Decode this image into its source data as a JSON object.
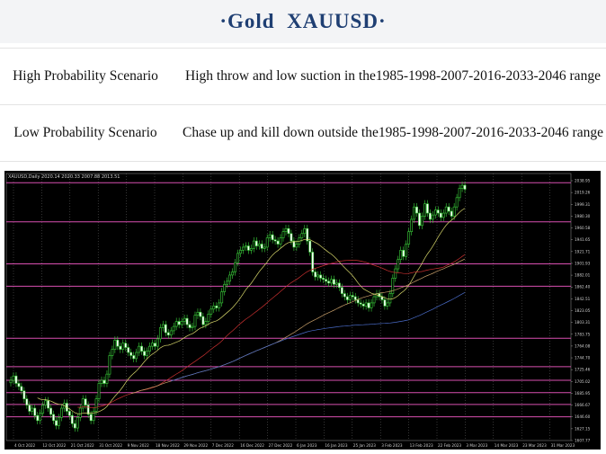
{
  "title": "·Gold  XAUUSD·",
  "scenarios": [
    {
      "label": "High Probability Scenario",
      "text": "High throw and low suction in the1985-1998-2007-2016-2033-2046 range"
    },
    {
      "label": "Low Probability Scenario",
      "text": "Chase up and kill down outside the1985-1998-2007-2016-2033-2046 range"
    }
  ],
  "chart_data": {
    "type": "line",
    "symbol_header": "XAUUSD,Daily  2020.14 2020.33 2007.88 2013.51",
    "x_tick_labels": [
      "4 Oct 2022",
      "12 Oct 2022",
      "21 Oct 2022",
      "31 Oct 2022",
      "9 Nov 2022",
      "18 Nov 2022",
      "29 Nov 2022",
      "7 Dec 2022",
      "16 Dec 2022",
      "27 Dec 2022",
      "6 Jan 2023",
      "16 Jan 2023",
      "25 Jan 2023",
      "3 Feb 2023",
      "13 Feb 2023",
      "22 Feb 2023",
      "3 Mar 2023",
      "14 Mar 2023",
      "23 Mar 2023",
      "31 Mar 2023"
    ],
    "y_tick_labels": [
      "2038.95",
      "2019.26",
      "1999.31",
      "1980.30",
      "1960.58",
      "1941.65",
      "1921.71",
      "1901.93",
      "1882.01",
      "1862.40",
      "1842.51",
      "1823.05",
      "1803.31",
      "1783.75",
      "1764.08",
      "1744.70",
      "1725.46",
      "1705.02",
      "1685.95",
      "1666.67",
      "1646.60",
      "1627.15",
      "1607.77"
    ],
    "ylim": [
      1607.77,
      2038.95
    ],
    "horizontal_levels": [
      2024,
      1961,
      1893,
      1857,
      1773,
      1727,
      1705,
      1685,
      1666,
      1646
    ],
    "candles_close": [
      1705,
      1712,
      1700,
      1695,
      1688,
      1675,
      1665,
      1655,
      1660,
      1648,
      1640,
      1652,
      1665,
      1672,
      1660,
      1650,
      1640,
      1632,
      1645,
      1660,
      1668,
      1655,
      1648,
      1635,
      1628,
      1645,
      1660,
      1675,
      1665,
      1650,
      1640,
      1655,
      1675,
      1700,
      1705,
      1700,
      1715,
      1745,
      1755,
      1770,
      1760,
      1755,
      1765,
      1758,
      1750,
      1745,
      1740,
      1750,
      1760,
      1752,
      1745,
      1752,
      1760,
      1765,
      1760,
      1772,
      1790,
      1795,
      1782,
      1778,
      1785,
      1792,
      1800,
      1795,
      1800,
      1805,
      1795,
      1790,
      1792,
      1810,
      1815,
      1808,
      1795,
      1800,
      1812,
      1820,
      1825,
      1822,
      1830,
      1848,
      1860,
      1865,
      1875,
      1880,
      1895,
      1910,
      1915,
      1920,
      1922,
      1915,
      1918,
      1930,
      1922,
      1925,
      1918,
      1920,
      1935,
      1940,
      1932,
      1930,
      1925,
      1935,
      1945,
      1950,
      1942,
      1930,
      1920,
      1925,
      1935,
      1942,
      1950,
      1930,
      1912,
      1880,
      1872,
      1875,
      1870,
      1868,
      1865,
      1862,
      1868,
      1860,
      1862,
      1855,
      1845,
      1840,
      1835,
      1842,
      1840,
      1835,
      1830,
      1828,
      1825,
      1830,
      1822,
      1830,
      1840,
      1845,
      1840,
      1835,
      1825,
      1830,
      1845,
      1870,
      1885,
      1900,
      1915,
      1905,
      1925,
      1945,
      1965,
      1985,
      1975,
      1955,
      1970,
      1990,
      1975,
      1965,
      1972,
      1980,
      1975,
      1968,
      1975,
      1985,
      1978,
      1970,
      1985,
      2000,
      2015,
      2020,
      2013.51
    ]
  }
}
